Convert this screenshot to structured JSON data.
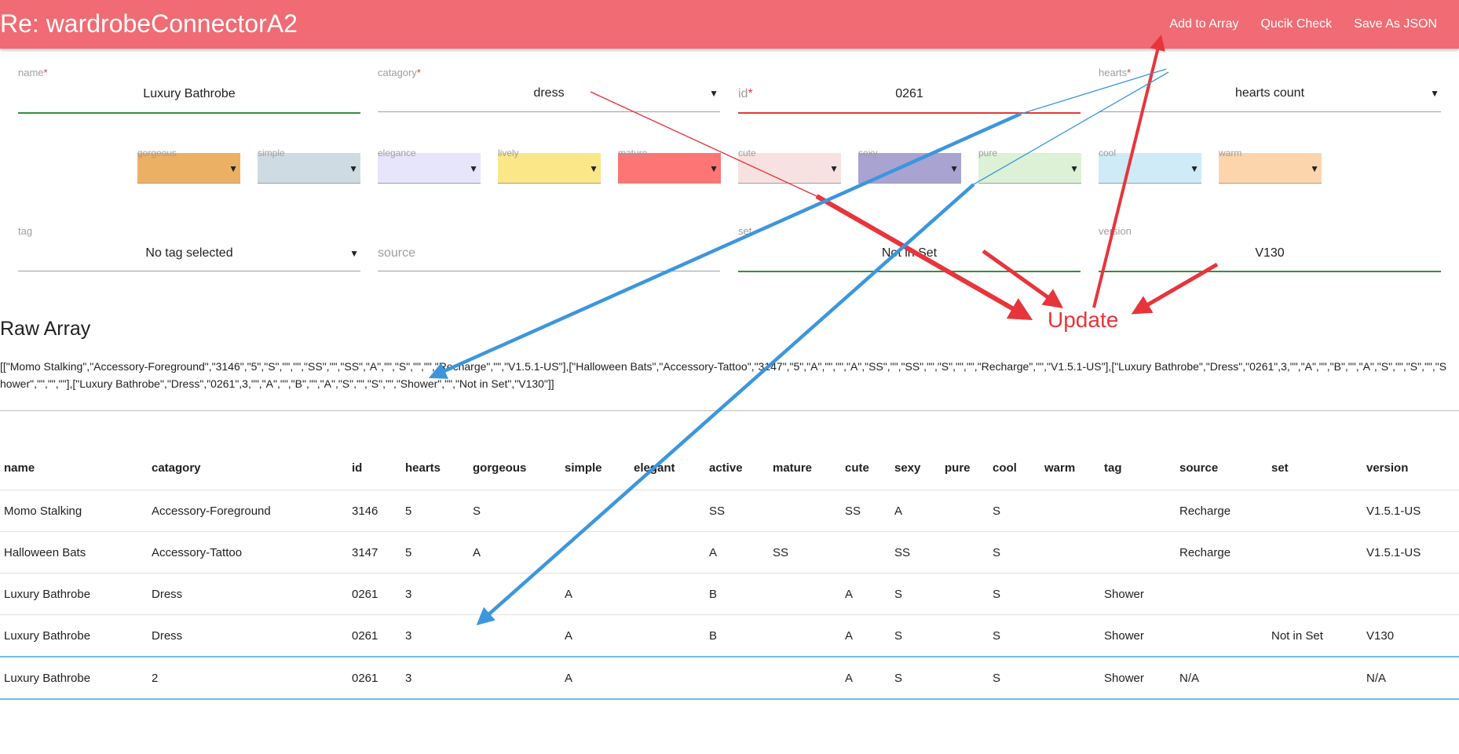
{
  "header": {
    "title": "Re: wardrobeConnectorA2",
    "actions": [
      "Add to Array",
      "Qucik Check",
      "Save As JSON"
    ]
  },
  "form": {
    "name": {
      "label": "name",
      "value": "Luxury Bathrobe"
    },
    "category": {
      "label": "catagory",
      "value": "dress"
    },
    "id": {
      "label": "id",
      "value": "0261"
    },
    "hearts": {
      "label": "hearts",
      "value": "hearts count"
    },
    "tag": {
      "label": "tag",
      "value": "No tag selected"
    },
    "source": {
      "placeholder": "source"
    },
    "set": {
      "label": "set",
      "value": "Not in Set"
    },
    "version": {
      "label": "version",
      "value": "V130"
    }
  },
  "styles": [
    {
      "label": "gorgeous",
      "color": "#ecb064"
    },
    {
      "label": "simple",
      "color": "#cfdbe3"
    },
    {
      "label": "elegance",
      "color": "#e6e5fc"
    },
    {
      "label": "lively",
      "color": "#fae787"
    },
    {
      "label": "mature",
      "color": "#fd7575"
    },
    {
      "label": "cute",
      "color": "#f8e1e1"
    },
    {
      "label": "sexy",
      "color": "#a9a3d2"
    },
    {
      "label": "pure",
      "color": "#dcf1d5"
    },
    {
      "label": "cool",
      "color": "#cfebf7"
    },
    {
      "label": "warm",
      "color": "#fdd5ad"
    }
  ],
  "raw": {
    "title": "Raw Array",
    "text": "[[\"Momo Stalking\",\"Accessory-Foreground\",\"3146\",\"5\",\"S\",\"\",\"\",\"SS\",\"\",\"SS\",\"A\",\"\",\"S\",\"\",\"\",\"Recharge\",\"\",\"V1.5.1-US\"],[\"Halloween Bats\",\"Accessory-Tattoo\",\"3147\",\"5\",\"A\",\"\",\"\",\"A\",\"SS\",\"\",\"SS\",\"\",\"S\",\"\",\"\",\"Recharge\",\"\",\"V1.5.1-US\"],[\"Luxury Bathrobe\",\"Dress\",\"0261\",3,\"\",\"A\",\"\",\"B\",\"\",\"A\",\"S\",\"\",\"S\",\"\",\"Shower\",\"\",\"\",\"\"],[\"Luxury Bathrobe\",\"Dress\",\"0261\",3,\"\",\"A\",\"\",\"B\",\"\",\"A\",\"S\",\"\",\"S\",\"\",\"Shower\",\"\",\"Not in Set\",\"V130\"]]"
  },
  "table": {
    "columns": [
      "name",
      "catagory",
      "id",
      "hearts",
      "gorgeous",
      "simple",
      "elegant",
      "active",
      "mature",
      "cute",
      "sexy",
      "pure",
      "cool",
      "warm",
      "tag",
      "source",
      "set",
      "version"
    ],
    "rows": [
      [
        "Momo Stalking",
        "Accessory-Foreground",
        "3146",
        "5",
        "S",
        "",
        "",
        "SS",
        "",
        "SS",
        "A",
        "",
        "S",
        "",
        "",
        "Recharge",
        "",
        "V1.5.1-US"
      ],
      [
        "Halloween Bats",
        "Accessory-Tattoo",
        "3147",
        "5",
        "A",
        "",
        "",
        "A",
        "SS",
        "",
        "SS",
        "",
        "S",
        "",
        "",
        "Recharge",
        "",
        "V1.5.1-US"
      ],
      [
        "Luxury Bathrobe",
        "Dress",
        "0261",
        "3",
        "",
        "A",
        "",
        "B",
        "",
        "A",
        "S",
        "",
        "S",
        "",
        "Shower",
        "",
        "",
        ""
      ],
      [
        "Luxury Bathrobe",
        "Dress",
        "0261",
        "3",
        "",
        "A",
        "",
        "B",
        "",
        "A",
        "S",
        "",
        "S",
        "",
        "Shower",
        "",
        "Not in Set",
        "V130"
      ],
      [
        "Luxury Bathrobe",
        "2",
        "0261",
        "3",
        "",
        "A",
        "",
        "",
        "",
        "A",
        "S",
        "",
        "S",
        "",
        "Shower",
        "N/A",
        "",
        "N/A"
      ]
    ],
    "selected_row": 4
  },
  "annotation": {
    "label": "Update",
    "colors": {
      "red": "#e8343b",
      "blue": "#3c96dd"
    }
  }
}
